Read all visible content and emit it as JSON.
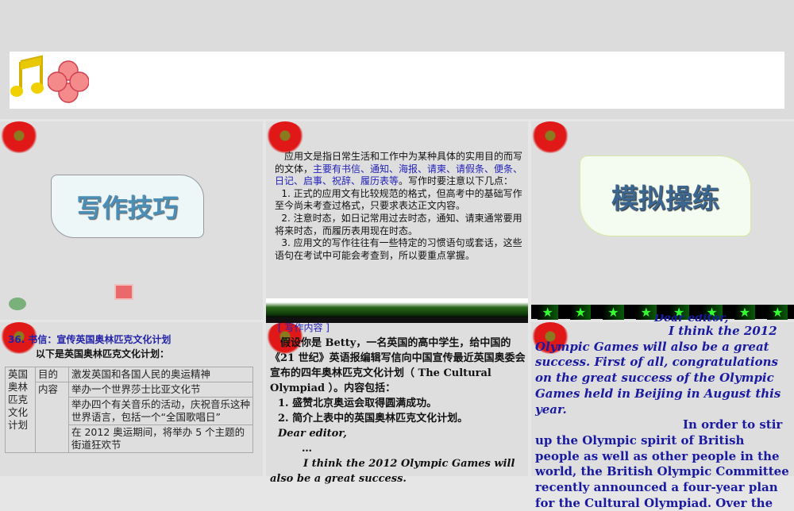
{
  "slide2": {
    "intro": "应用文是指日常生活和工作中为某种具体的实用目的而写的文体，",
    "highlight": "主要有书信、通知、海报、请柬、请假条、便条、日记、启事、祝辞、履历表等",
    "rest": "。写作时要注意以下几点：",
    "points": [
      "1. 正式的应用文有比较规范的格式，但高考中的基础写作至今尚未考查过格式，只要求表达正文内容。",
      "2. 注意时态，如日记常用过去时态，通知、请柬通常要用将来时态，而履历表用现在时态。",
      "3. 应用文的写作往往有一些特定的习惯语句或套话，这些语句在考试中可能会考查到，所以要重点掌握。"
    ]
  },
  "slide1": {
    "title": "写作技巧"
  },
  "slide3": {
    "title": "模拟操练"
  },
  "slide4": {
    "title": "36. 书信：宣传英国奥林匹克文化计划",
    "subtitle": "以下是英国奥林匹克文化计划：",
    "table": {
      "plan": "英国奥林匹克文化计划",
      "purpose_label": "目的",
      "purpose": "激发英国和各国人民的奥运精神",
      "content_label": "内容",
      "items": [
        "举办一个世界莎士比亚文化节",
        "举办四个有关音乐的活动，庆祝音乐这种世界语言，包括一个“全国歌唱日”",
        "在 2012 奥运期间，将举办 5 个主题的街道狂欢节"
      ]
    }
  },
  "slide5": {
    "heading": "[ 写作内容 ]",
    "body": "假设你是 Betty，一名英国的高中学生，给中国的《21 世纪》英语报编辑写信向中国宣传最近英国奥委会宣布的四年奥林匹克文化计划（ The Cultural Olympiad ）。内容包括：",
    "points": [
      "1. 盛赞北京奥运会取得圆满成功。",
      "2. 简介上表中的英国奥林匹克文化计划。"
    ],
    "greeting": "Dear editor,",
    "ellipsis": "…",
    "sentence": "I think the 2012 Olympic Games will also be a great success."
  },
  "slide6": {
    "greeting": "Dear editor,",
    "para1": "I think the 2012 Olympic Games will also be a great success. First of all, congratulations on the great success of the Olympic Games held in Beijing in August this year.",
    "para2": "In order to stir up the Olympic spirit of British people as well as other people in the world, the British Olympic Committee recently announced a four-year plan for the Cultural Olympiad. Over the"
  }
}
